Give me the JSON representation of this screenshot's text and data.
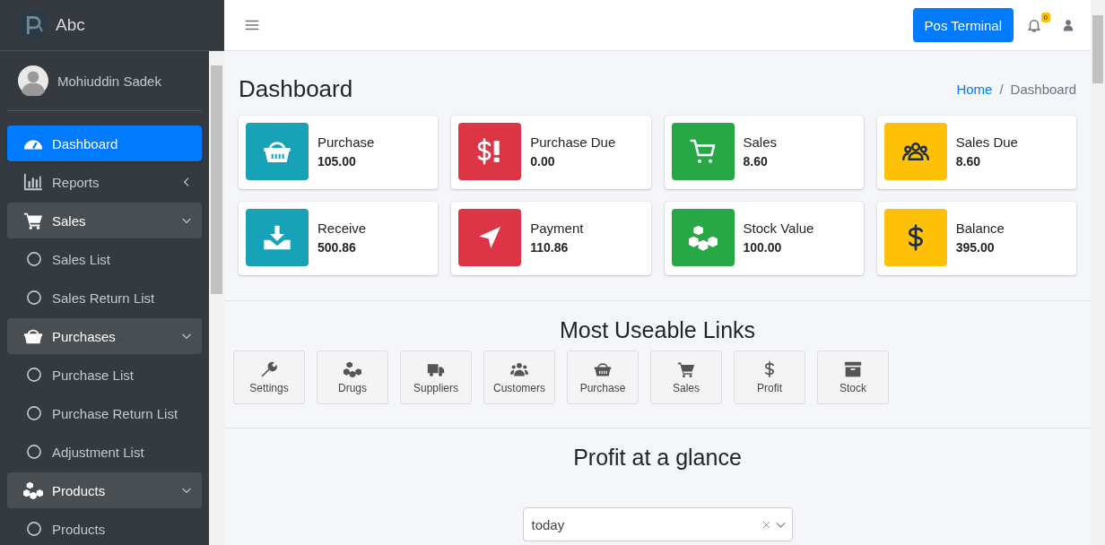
{
  "brand": {
    "name": "Abc"
  },
  "user": {
    "name": "Mohiuddin Sadek"
  },
  "sidebar": {
    "items": [
      {
        "label": "Dashboard",
        "selected": true
      },
      {
        "label": "Reports",
        "selected": false,
        "expanded": false
      },
      {
        "label": "Sales",
        "selected": false,
        "expanded": true,
        "children": [
          {
            "label": "Sales List",
            "selected": false
          },
          {
            "label": "Sales Return List",
            "selected": false
          }
        ]
      },
      {
        "label": "Purchases",
        "selected": false,
        "expanded": true,
        "children": [
          {
            "label": "Purchase List",
            "selected": false
          },
          {
            "label": "Purchase Return List",
            "selected": false
          },
          {
            "label": "Adjustment List",
            "selected": false
          }
        ]
      },
      {
        "label": "Products",
        "selected": false,
        "expanded": true,
        "children": [
          {
            "label": "Products",
            "selected": false
          }
        ]
      }
    ]
  },
  "topbar": {
    "button": "Pos Terminal",
    "notification_count": "0"
  },
  "page": {
    "title": "Dashboard",
    "breadcrumb_separator": "/",
    "breadcrumb": [
      {
        "label": "Home",
        "link": true
      },
      {
        "label": "Dashboard",
        "link": false
      }
    ]
  },
  "stats": [
    {
      "label": "Purchase",
      "value": "105.00",
      "color": "#17a2b8"
    },
    {
      "label": "Purchase Due",
      "value": "0.00",
      "color": "#dc3545"
    },
    {
      "label": "Sales",
      "value": "8.60",
      "color": "#28a745"
    },
    {
      "label": "Sales Due",
      "value": "8.60",
      "color": "#ffc107"
    },
    {
      "label": "Receive",
      "value": "500.86",
      "color": "#17a2b8"
    },
    {
      "label": "Payment",
      "value": "110.86",
      "color": "#dc3545"
    },
    {
      "label": "Stock Value",
      "value": "100.00",
      "color": "#28a745"
    },
    {
      "label": "Balance",
      "value": "395.00",
      "color": "#ffc107"
    }
  ],
  "quick_links": {
    "title": "Most Useable Links",
    "items": [
      "Settings",
      "Drugs",
      "Suppliers",
      "Customers",
      "Purchase",
      "Sales",
      "Profit",
      "Stock"
    ]
  },
  "profit": {
    "title": "Profit at a glance",
    "period": {
      "value": "today"
    }
  }
}
